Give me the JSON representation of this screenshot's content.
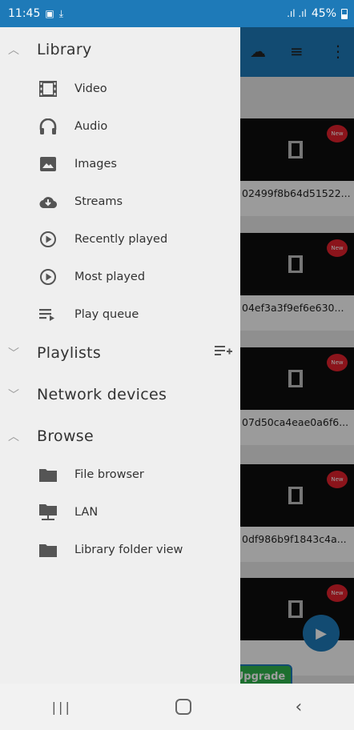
{
  "status_bar": {
    "time": "11:45",
    "signal": ".ıl .ıl",
    "battery": "45%"
  },
  "drawer": {
    "library": {
      "label": "Library",
      "items": [
        {
          "label": "Video",
          "icon": "video-icon"
        },
        {
          "label": "Audio",
          "icon": "headphones-icon"
        },
        {
          "label": "Images",
          "icon": "image-icon"
        },
        {
          "label": "Streams",
          "icon": "cloud-download-icon"
        },
        {
          "label": "Recently played",
          "icon": "play-circle-icon"
        },
        {
          "label": "Most played",
          "icon": "play-circle-icon"
        },
        {
          "label": "Play queue",
          "icon": "queue-icon"
        }
      ]
    },
    "playlists": {
      "label": "Playlists"
    },
    "network": {
      "label": "Network devices"
    },
    "browse": {
      "label": "Browse",
      "items": [
        {
          "label": "File browser",
          "icon": "folder-icon"
        },
        {
          "label": "LAN",
          "icon": "network-folder-icon"
        },
        {
          "label": "Library folder view",
          "icon": "folder-icon"
        }
      ]
    }
  },
  "background": {
    "cards": [
      {
        "title": "02499f8b64d51522...",
        "badge": "New"
      },
      {
        "title": "04ef3a3f9ef6e630...",
        "badge": "New"
      },
      {
        "title": "07d50ca4eae0a6f6...",
        "badge": "New"
      },
      {
        "title": "0df986b9f1843c4a...",
        "badge": "New"
      },
      {
        "title": "",
        "badge": "New"
      }
    ],
    "upgrade": "Upgrade"
  },
  "colors": {
    "accent": "#1e7ab8",
    "badge": "#e0212c",
    "upgrade": "#2fb34c"
  }
}
